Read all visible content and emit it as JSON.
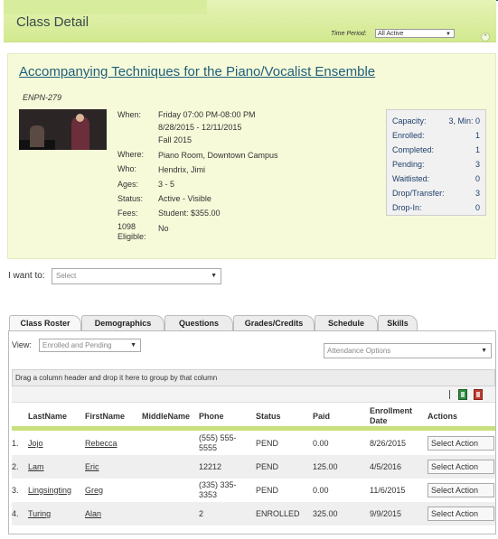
{
  "header": {
    "title": "Class Detail",
    "time_period_label": "Time Period:",
    "time_period_value": "All Active",
    "collapse_icon": "chevron-up-icon"
  },
  "class_info": {
    "title": "Accompanying Techniques for the Piano/Vocalist Ensemble",
    "code": "ENPN-279",
    "details": [
      {
        "label": "When:",
        "value_lines": [
          "Friday 07:00 PM-08:00 PM",
          "8/28/2015 - 12/11/2015",
          "Fall 2015"
        ]
      },
      {
        "label": "Where:",
        "value_lines": [
          "Piano Room, Downtown Campus"
        ]
      },
      {
        "label": "Who:",
        "value_lines": [
          "Hendrix, Jimi"
        ]
      },
      {
        "label": "Ages:",
        "value_lines": [
          "3 - 5"
        ]
      },
      {
        "label": "Status:",
        "value_lines": [
          "Active - Visible"
        ]
      },
      {
        "label": "Fees:",
        "value_lines": [
          "Student: $355.00"
        ]
      },
      {
        "label": "1098 Eligible:",
        "value_lines": [
          "No"
        ]
      }
    ]
  },
  "stats": [
    {
      "label": "Capacity:",
      "value": "3, Min: 0"
    },
    {
      "label": "Enrolled:",
      "value": "1"
    },
    {
      "label": "Completed:",
      "value": "1"
    },
    {
      "label": "Pending:",
      "value": "3"
    },
    {
      "label": "Waitlisted:",
      "value": "0"
    },
    {
      "label": "Drop/Transfer:",
      "value": "3"
    },
    {
      "label": "Drop-In:",
      "value": "0"
    }
  ],
  "i_want_to": {
    "label": "I want to:",
    "placeholder": "Select"
  },
  "tabs": [
    "Class Roster",
    "Demographics",
    "Questions",
    "Grades/Credits",
    "Schedule",
    "Skills"
  ],
  "roster": {
    "view_label": "View:",
    "view_value": "Enrolled and Pending",
    "attendance_placeholder": "Attendance Options",
    "group_hint": "Drag a column header and drop it here to group by that column",
    "columns": [
      "LastName",
      "FirstName",
      "MiddleName",
      "Phone",
      "Status",
      "Paid",
      "Enrollment Date",
      "Actions"
    ],
    "rows": [
      {
        "num": "1.",
        "last": "Jojo",
        "first": "Rebecca",
        "middle": "",
        "phone": "(555) 555-5555",
        "status": "PEND",
        "paid": "0.00",
        "date": "8/26/2015",
        "action": "Select Action"
      },
      {
        "num": "2.",
        "last": "Lam",
        "first": "Eric",
        "middle": "",
        "phone": "12212",
        "status": "PEND",
        "paid": "125.00",
        "date": "4/5/2016",
        "action": "Select Action"
      },
      {
        "num": "3.",
        "last": "Lingsingting",
        "first": "Greg",
        "middle": "",
        "phone": "(335) 335-3353",
        "status": "PEND",
        "paid": "0.00",
        "date": "11/6/2015",
        "action": "Select Action"
      },
      {
        "num": "4.",
        "last": "Turing",
        "first": "Alan",
        "middle": "",
        "phone": "2",
        "status": "ENROLLED",
        "paid": "325.00",
        "date": "9/9/2015",
        "action": "Select Action"
      }
    ]
  }
}
